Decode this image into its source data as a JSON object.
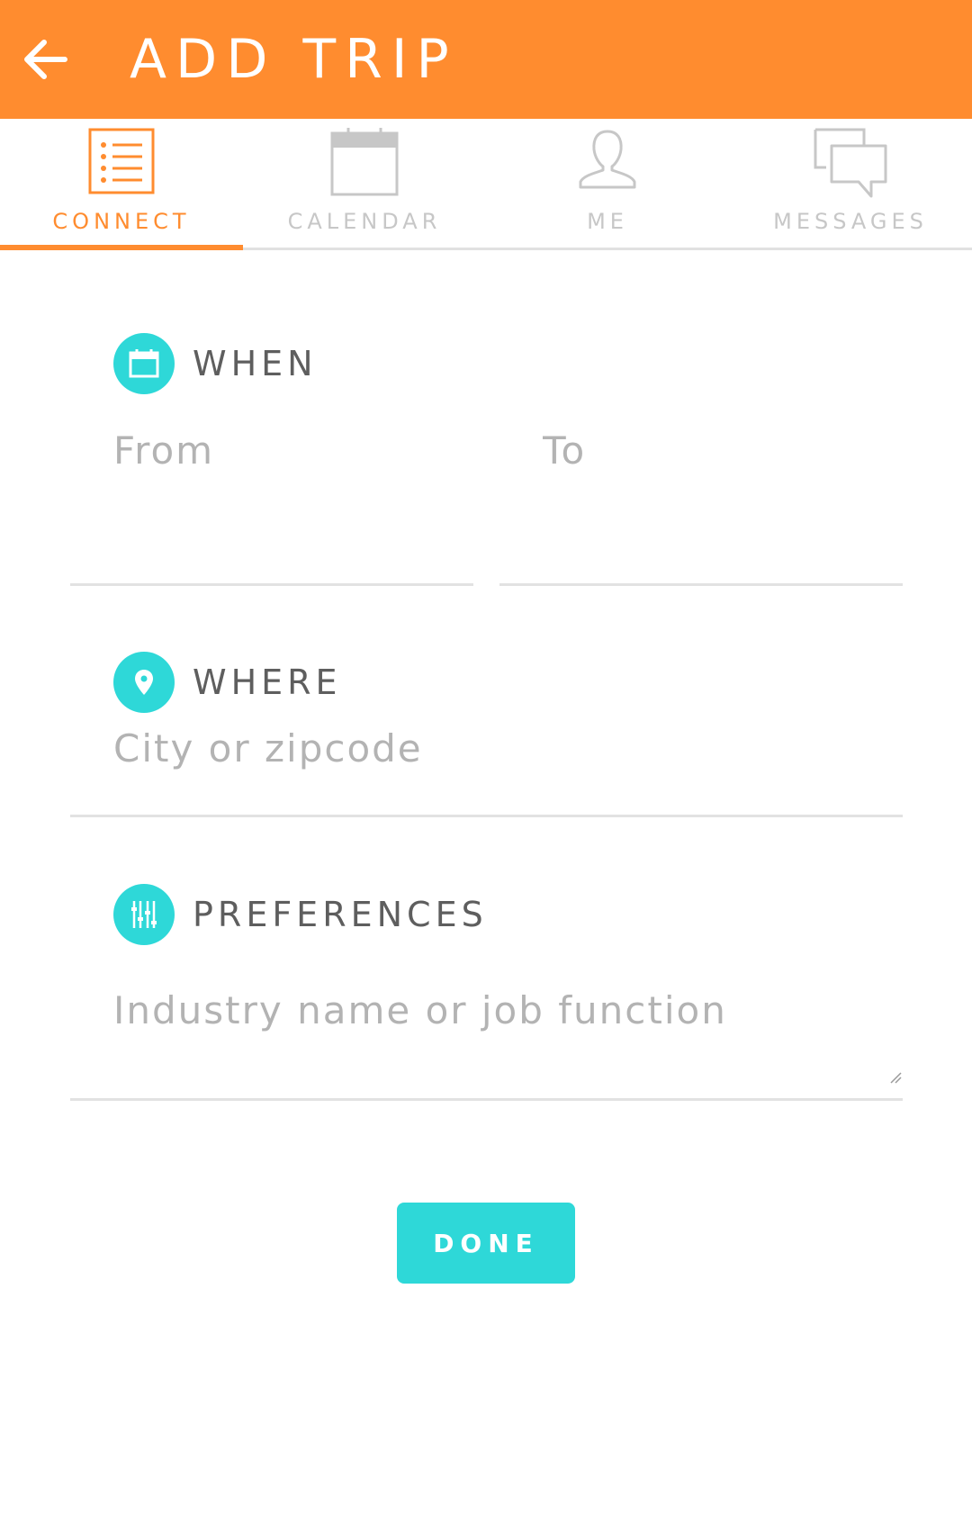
{
  "colors": {
    "accent_orange": "#FF8C2F",
    "accent_teal": "#2ED8D8",
    "tab_inactive": "#C7C7C7",
    "section_title": "#5E5E5E",
    "placeholder": "#B3B3B3"
  },
  "header": {
    "title": "ADD TRIP",
    "back_icon": "arrow-left-icon"
  },
  "tabs": [
    {
      "label": "CONNECT",
      "icon": "list-icon",
      "active": true
    },
    {
      "label": "CALENDAR",
      "icon": "calendar-icon",
      "active": false
    },
    {
      "label": "ME",
      "icon": "person-icon",
      "active": false
    },
    {
      "label": "MESSAGES",
      "icon": "chat-bubbles-icon",
      "active": false
    }
  ],
  "when": {
    "title": "WHEN",
    "icon": "calendar-icon",
    "from_placeholder": "From",
    "to_placeholder": "To"
  },
  "where": {
    "title": "WHERE",
    "icon": "location-pin-icon",
    "placeholder": "City or zipcode"
  },
  "preferences": {
    "title": "PREFERENCES",
    "icon": "sliders-icon",
    "placeholder": "Industry name or job function"
  },
  "done_label": "DONE"
}
